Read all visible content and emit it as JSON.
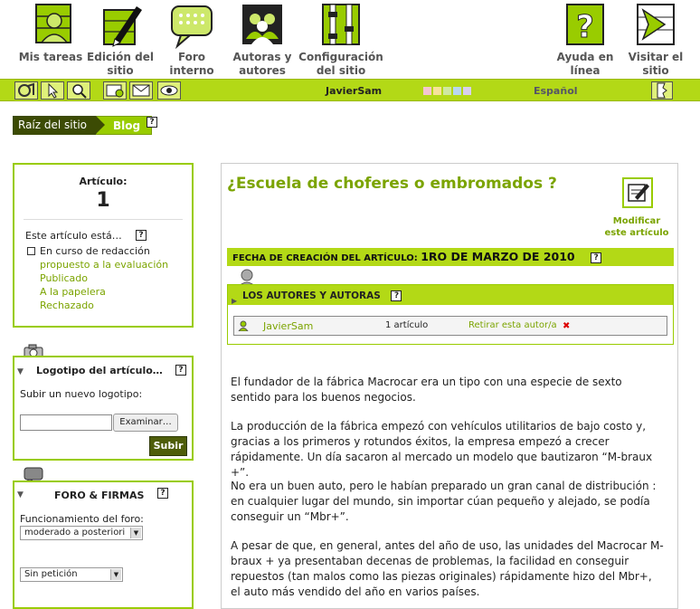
{
  "topnav": {
    "items": [
      {
        "label": "Mis tareas",
        "icon": "tasks-user-icon"
      },
      {
        "label": "Edición del\nsitio",
        "icon": "pen-icon"
      },
      {
        "label": "Foro\ninterno",
        "icon": "forum-icon"
      },
      {
        "label": "Autoras y\nautores",
        "icon": "authors-icon"
      },
      {
        "label": "Configuración\ndel sitio",
        "icon": "config-icon"
      },
      {
        "label": "Ayuda en\nlínea",
        "icon": "help-icon"
      },
      {
        "label": "Visitar el\nsitio",
        "icon": "visit-icon"
      }
    ]
  },
  "toolbar": {
    "user": "JavierSam",
    "language": "Español",
    "swatch_colors": [
      "#f4c6d0",
      "#f6e39a",
      "#cfe8a0",
      "#b9d7ee",
      "#d8d0ee"
    ]
  },
  "breadcrumb": {
    "root": "Raíz del sitio",
    "current": "Blog",
    "help": "?"
  },
  "article_panel": {
    "label": "Artículo:",
    "number": "1",
    "status_heading": "Este artículo está…",
    "status_current": "En curso de redacción",
    "status_options": [
      "propuesto a la evaluación",
      "Publicado",
      "A la papelera",
      "Rechazado"
    ]
  },
  "logo_panel": {
    "title": "Logotipo del artículo…",
    "subtitle": "Subir un nuevo logotipo:",
    "browse_label": "Examinar…",
    "submit_label": "Subir"
  },
  "forum_panel": {
    "title": "FORO & FIRMAS",
    "mode_label": "Funcionamiento del foro:",
    "mode_value": "moderado a posteriori",
    "signature_value": "Sin petición"
  },
  "article": {
    "title": "¿Escuela de choferes o embromados ?",
    "edit_label": "Modificar\neste artículo",
    "date_label": "FECHA DE CREACIÓN DEL ARTÍCULO:",
    "date_value": "1RO DE MARZO DE 2010",
    "authors_title": "LOS AUTORES Y AUTORAS",
    "author_name": "JavierSam",
    "author_count": "1 artículo",
    "remove_label": "Retirar esta autor/a",
    "paragraphs": [
      "El fundador de la fábrica Macrocar era un tipo con una especie de sexto sentido para los buenos negocios.",
      "La producción de la fábrica empezó con vehículos utilitarios de bajo costo y, gracias a los primeros y rotundos éxitos, la empresa empezó a crecer rápidamente. Un día sacaron al mercado un modelo que bautizaron “M-braux +”.",
      "No era un buen auto, pero le habían preparado un gran canal de distribución : en cualquier lugar del mundo, sin importar cúan pequeño y alejado, se podía conseguir un “Mbr+”.",
      "A pesar de que, en general, antes del año de uso, las unidades del Macrocar M-braux + ya presentaban decenas de problemas, la facilidad en conseguir repuestos (tan malos como las piezas originales) rápidamente hizo del Mbr+, el auto más vendido del año en varios países."
    ]
  }
}
